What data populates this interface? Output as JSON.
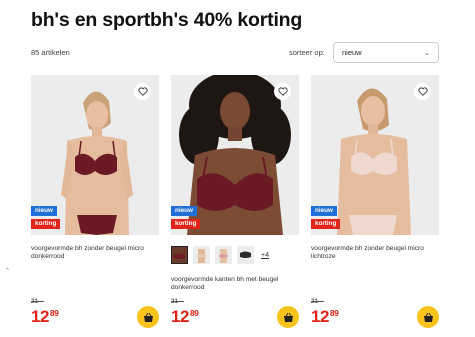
{
  "page": {
    "title": "bh's en sportbh's 40% korting"
  },
  "toolbar": {
    "count": "85 artikelen",
    "sort_label": "sorteer op:",
    "sort_value": "nieuw"
  },
  "side_mark": "^",
  "products": [
    {
      "badge_new": "nieuw",
      "badge_discount": "korting",
      "name": "voorgevormde bh zonder beugel micro donkerrood",
      "old_price": "21—",
      "price_main": "12",
      "price_cents": "89"
    },
    {
      "badge_new": "nieuw",
      "badge_discount": "korting",
      "name": "voorgevormde kanten bh met beugel donkerrood",
      "old_price": "21—",
      "price_main": "12",
      "price_cents": "89",
      "swatches_more": "+4"
    },
    {
      "badge_new": "nieuw",
      "badge_discount": "korting",
      "name": "voorgevormde bh zonder beugel micro lichtroze",
      "old_price": "21—",
      "price_main": "12",
      "price_cents": "89"
    }
  ],
  "colors": {
    "discount_red": "#e2231a",
    "new_blue": "#1f6fd6",
    "cart_yellow": "#f7c31a",
    "bra_dark_red": "#6b1a24",
    "bra_light_pink": "#efd9cf"
  }
}
